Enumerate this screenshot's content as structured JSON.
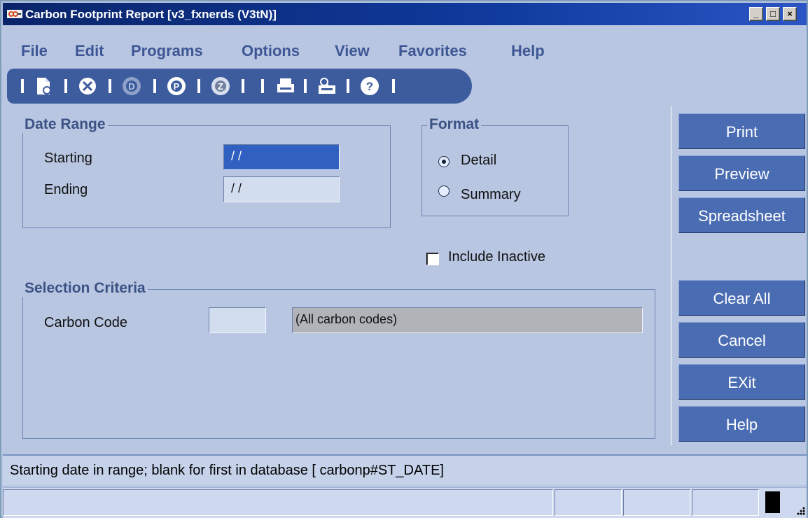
{
  "window": {
    "title": "Carbon Footprint Report [v3_fxnerds (V3tN)]",
    "controls": [
      "_",
      "□",
      "×"
    ]
  },
  "menu": [
    "File",
    "Edit",
    "Programs",
    "Options",
    "View",
    "Favorites",
    "Help"
  ],
  "toolbar": {
    "icons": [
      "new-document-icon",
      "cancel-icon",
      "d-disabled-icon",
      "p-icon",
      "z-icon",
      "print-icon",
      "print-preview-icon",
      "help-icon"
    ]
  },
  "date_range": {
    "title": "Date Range",
    "starting_label": "Starting",
    "starting_value": "/ /",
    "ending_label": "Ending",
    "ending_value": "/ /"
  },
  "format": {
    "title": "Format",
    "options": [
      {
        "label": "Detail",
        "selected": true
      },
      {
        "label": "Summary",
        "selected": false
      }
    ]
  },
  "include_inactive": {
    "label": "Include Inactive",
    "checked": false
  },
  "selection_criteria": {
    "title": "Selection Criteria",
    "carbon_code_label": "Carbon Code",
    "carbon_code_value": "",
    "carbon_code_description": "(All carbon codes)"
  },
  "buttons": {
    "print": "Print",
    "preview": "Preview",
    "spreadsheet": "Spreadsheet",
    "clear_all": "Clear All",
    "cancel": "Cancel",
    "exit": "EXit",
    "help": "Help"
  },
  "status": {
    "message": "Starting date in range; blank for first in database [ carbonp#ST_DATE]"
  },
  "colors": {
    "background": "#b8c6e2",
    "title_bar": "#0a246a",
    "menu_text": "#3e5794",
    "button": "#4a6cb2",
    "active_field": "#3060c0"
  }
}
